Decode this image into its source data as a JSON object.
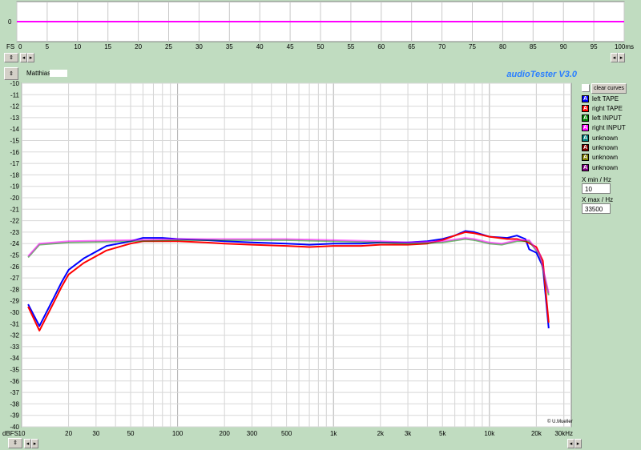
{
  "osc": {
    "fs_label": "FS",
    "zero_label": "0",
    "x_ticks": [
      "0",
      "5",
      "10",
      "15",
      "20",
      "25",
      "30",
      "35",
      "40",
      "45",
      "50",
      "55",
      "60",
      "65",
      "70",
      "75",
      "80",
      "85",
      "90",
      "95",
      "100ms"
    ],
    "trace_color": "#ff00ff"
  },
  "header": {
    "user_name": "Matthias",
    "app_title": "audioTester  V3.0"
  },
  "y_axis": {
    "unit_label": "dBFS",
    "ticks": [
      -10,
      -11,
      -12,
      -13,
      -14,
      -15,
      -16,
      -17,
      -18,
      -19,
      -20,
      -21,
      -22,
      -23,
      -24,
      -25,
      -26,
      -27,
      -28,
      -29,
      -30,
      -31,
      -32,
      -33,
      -34,
      -35,
      -36,
      -37,
      -38,
      -39,
      -40
    ]
  },
  "x_axis": {
    "labels": [
      {
        "f": 10,
        "t": "10"
      },
      {
        "f": 20,
        "t": "20"
      },
      {
        "f": 30,
        "t": "30"
      },
      {
        "f": 50,
        "t": "50"
      },
      {
        "f": 100,
        "t": "100"
      },
      {
        "f": 200,
        "t": "200"
      },
      {
        "f": 300,
        "t": "300"
      },
      {
        "f": 500,
        "t": "500"
      },
      {
        "f": 1000,
        "t": "1k"
      },
      {
        "f": 2000,
        "t": "2k"
      },
      {
        "f": 3000,
        "t": "3k"
      },
      {
        "f": 5000,
        "t": "5k"
      },
      {
        "f": 10000,
        "t": "10k"
      },
      {
        "f": 20000,
        "t": "20k"
      },
      {
        "f": 30000,
        "t": "30kHz"
      }
    ]
  },
  "copyright": "© U.Mueller",
  "sidebar": {
    "clear_label": "clear curves",
    "legend": [
      {
        "label": "left TAPE",
        "color": "#0000ff"
      },
      {
        "label": "right TAPE",
        "color": "#ff0000"
      },
      {
        "label": "left INPUT",
        "color": "#008000"
      },
      {
        "label": "right INPUT",
        "color": "#ff00ff"
      },
      {
        "label": "unknown",
        "color": "#008080"
      },
      {
        "label": "unknown",
        "color": "#800000"
      },
      {
        "label": "unknown",
        "color": "#808000"
      },
      {
        "label": "unknown",
        "color": "#800080"
      }
    ],
    "xmin_label": "X min / Hz",
    "xmin_value": "10",
    "xmax_label": "X max / Hz",
    "xmax_value": "33500"
  },
  "chart_data": {
    "type": "line",
    "x_scale": "log",
    "xlim": [
      10,
      33500
    ],
    "ylim": [
      -40,
      -10
    ],
    "ylabel": "dBFS",
    "grid": true,
    "series": [
      {
        "name": "left TAPE",
        "color": "#0000ff",
        "points": [
          [
            11,
            -29.3
          ],
          [
            13,
            -31.2
          ],
          [
            16,
            -28.8
          ],
          [
            18,
            -27.4
          ],
          [
            20,
            -26.3
          ],
          [
            25,
            -25.3
          ],
          [
            35,
            -24.2
          ],
          [
            50,
            -23.8
          ],
          [
            60,
            -23.5
          ],
          [
            70,
            -23.5
          ],
          [
            80,
            -23.5
          ],
          [
            100,
            -23.6
          ],
          [
            150,
            -23.7
          ],
          [
            200,
            -23.8
          ],
          [
            300,
            -23.9
          ],
          [
            500,
            -24.0
          ],
          [
            700,
            -24.1
          ],
          [
            1000,
            -24.0
          ],
          [
            1500,
            -24.0
          ],
          [
            2000,
            -23.9
          ],
          [
            3000,
            -23.9
          ],
          [
            4000,
            -23.8
          ],
          [
            5000,
            -23.6
          ],
          [
            6000,
            -23.3
          ],
          [
            7000,
            -22.9
          ],
          [
            8000,
            -23.0
          ],
          [
            10000,
            -23.4
          ],
          [
            13000,
            -23.5
          ],
          [
            15000,
            -23.3
          ],
          [
            17000,
            -23.6
          ],
          [
            18000,
            -24.5
          ],
          [
            20000,
            -24.8
          ],
          [
            22000,
            -26.0
          ],
          [
            24000,
            -31.4
          ]
        ]
      },
      {
        "name": "right TAPE",
        "color": "#ff0000",
        "points": [
          [
            11,
            -29.5
          ],
          [
            13,
            -31.6
          ],
          [
            16,
            -29.2
          ],
          [
            18,
            -27.8
          ],
          [
            20,
            -26.7
          ],
          [
            25,
            -25.7
          ],
          [
            35,
            -24.6
          ],
          [
            50,
            -24.0
          ],
          [
            60,
            -23.8
          ],
          [
            80,
            -23.8
          ],
          [
            100,
            -23.8
          ],
          [
            150,
            -23.9
          ],
          [
            200,
            -24.0
          ],
          [
            300,
            -24.1
          ],
          [
            500,
            -24.2
          ],
          [
            700,
            -24.3
          ],
          [
            1000,
            -24.2
          ],
          [
            1500,
            -24.2
          ],
          [
            2000,
            -24.1
          ],
          [
            3000,
            -24.1
          ],
          [
            4000,
            -24.0
          ],
          [
            5000,
            -23.7
          ],
          [
            6000,
            -23.3
          ],
          [
            7000,
            -23.0
          ],
          [
            8000,
            -23.1
          ],
          [
            10000,
            -23.4
          ],
          [
            13000,
            -23.6
          ],
          [
            15000,
            -23.6
          ],
          [
            17000,
            -23.8
          ],
          [
            20000,
            -24.3
          ],
          [
            22000,
            -25.5
          ],
          [
            24000,
            -30.9
          ]
        ]
      },
      {
        "name": "left INPUT",
        "color": "#008000",
        "points": [
          [
            11,
            -25.2
          ],
          [
            13,
            -24.1
          ],
          [
            20,
            -23.9
          ],
          [
            50,
            -23.8
          ],
          [
            100,
            -23.7
          ],
          [
            500,
            -23.7
          ],
          [
            1000,
            -23.8
          ],
          [
            2000,
            -23.9
          ],
          [
            3000,
            -24.0
          ],
          [
            5000,
            -23.9
          ],
          [
            7000,
            -23.6
          ],
          [
            8000,
            -23.7
          ],
          [
            10000,
            -24.0
          ],
          [
            12000,
            -24.1
          ],
          [
            15000,
            -23.8
          ],
          [
            18000,
            -23.8
          ],
          [
            21000,
            -25.0
          ],
          [
            24000,
            -28.5
          ]
        ]
      },
      {
        "name": "right INPUT",
        "color": "#ff00ff",
        "points": [
          [
            11,
            -25.1
          ],
          [
            13,
            -24.0
          ],
          [
            20,
            -23.8
          ],
          [
            50,
            -23.7
          ],
          [
            100,
            -23.6
          ],
          [
            500,
            -23.6
          ],
          [
            1000,
            -23.7
          ],
          [
            2000,
            -23.8
          ],
          [
            3000,
            -23.9
          ],
          [
            5000,
            -23.8
          ],
          [
            7000,
            -23.5
          ],
          [
            8000,
            -23.6
          ],
          [
            10000,
            -23.9
          ],
          [
            12000,
            -24.0
          ],
          [
            15000,
            -23.7
          ],
          [
            18000,
            -23.7
          ],
          [
            21000,
            -24.9
          ],
          [
            24000,
            -28.3
          ]
        ]
      }
    ]
  }
}
